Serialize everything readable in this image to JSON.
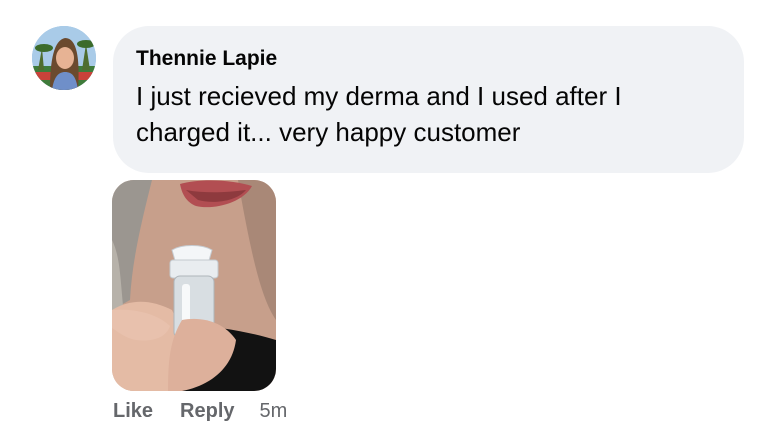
{
  "comment": {
    "author": "Thennie Lapie",
    "text": "I just recieved my derma and I used after I charged it... very happy customer",
    "avatar_icon": "user-avatar",
    "photo_icon": "attached-photo",
    "actions": {
      "like_label": "Like",
      "reply_label": "Reply",
      "timestamp": "5m"
    }
  },
  "colors": {
    "bubble_background": "#f0f2f5",
    "text_primary": "#050505",
    "text_secondary": "#65676b"
  }
}
